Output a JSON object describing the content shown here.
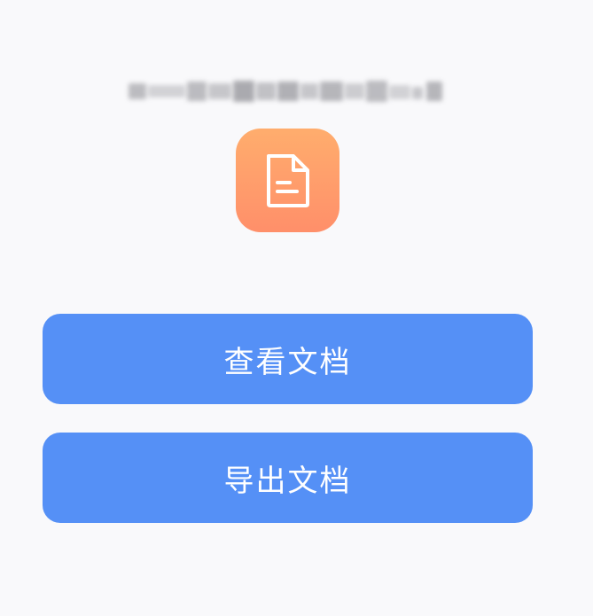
{
  "document": {
    "icon": "document-icon",
    "icon_color": "#ff9a6b",
    "filename_redacted": true
  },
  "actions": {
    "view_label": "查看文档",
    "export_label": "导出文档",
    "button_color": "#5590f6"
  }
}
